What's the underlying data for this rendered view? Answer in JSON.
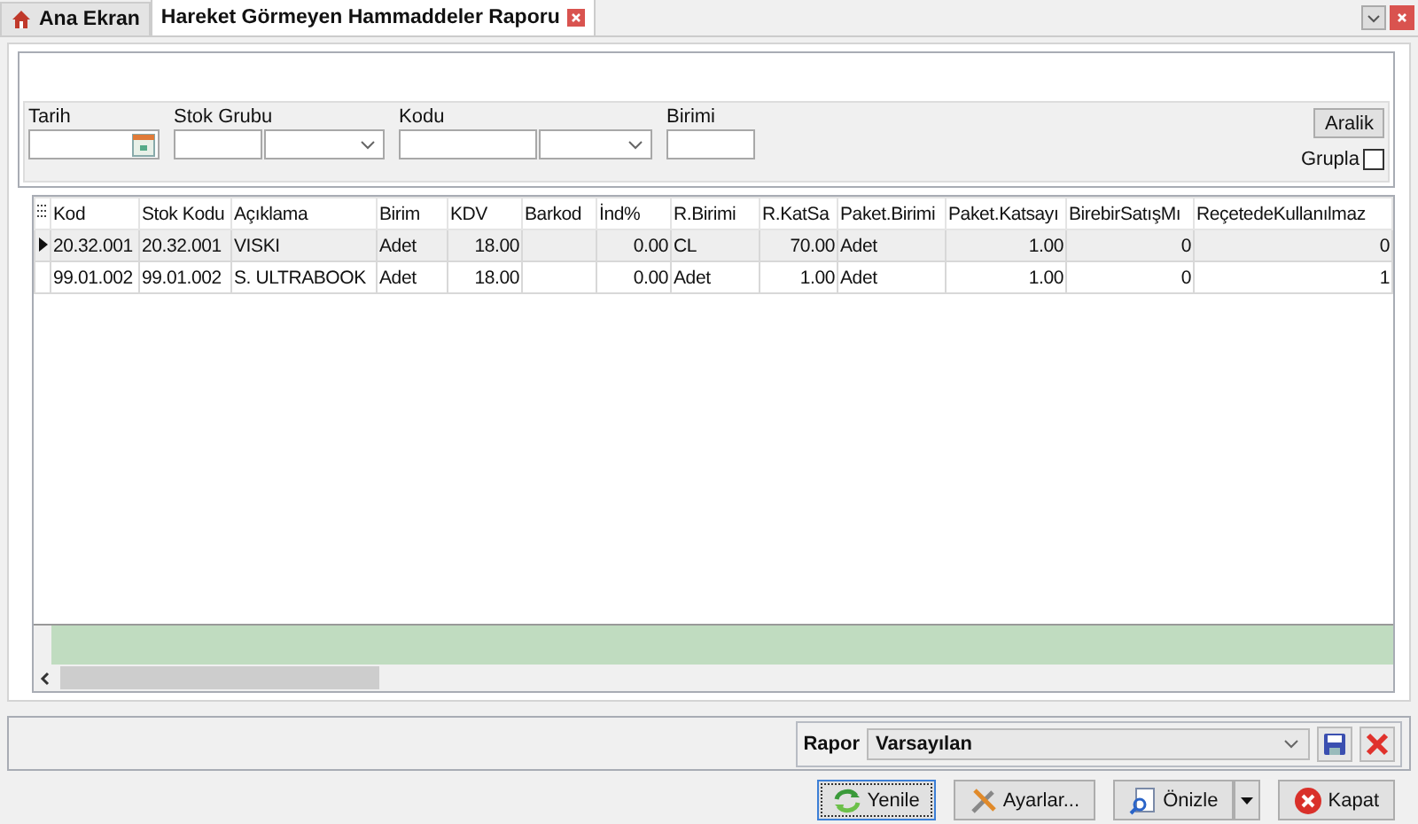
{
  "tabs": [
    {
      "label": "Ana Ekran",
      "selected": false,
      "kind": "home"
    },
    {
      "label": "Hareket Görmeyen Hammaddeler Raporu",
      "selected": true,
      "kind": "report"
    }
  ],
  "filters": [
    {
      "label": "Tarih",
      "kind": "date"
    },
    {
      "label": "Stok Grubu",
      "kind": "combo"
    },
    {
      "label": "Kodu",
      "kind": "combo"
    },
    {
      "label": "Birimi",
      "kind": "text"
    }
  ],
  "range_button": "Aralik",
  "group_checkbox": {
    "label": "Grupla",
    "checked": false
  },
  "table": {
    "columns": [
      {
        "label": "Kod",
        "kind": "text"
      },
      {
        "label": "Stok Kodu",
        "kind": "text"
      },
      {
        "label": "Açıklama",
        "kind": "text"
      },
      {
        "label": "Birim",
        "kind": "text"
      },
      {
        "label": "KDV",
        "kind": "number"
      },
      {
        "label": "Barkod",
        "kind": "text"
      },
      {
        "label": "İnd%",
        "kind": "number"
      },
      {
        "label": "R.Birimi",
        "kind": "text"
      },
      {
        "label": "R.KatSa",
        "kind": "number"
      },
      {
        "label": "Paket.Birimi",
        "kind": "text"
      },
      {
        "label": "Paket.Katsayı",
        "kind": "number"
      },
      {
        "label": "BirebirSatışMı",
        "kind": "number"
      },
      {
        "label": "ReçetedeKullanılmaz",
        "kind": "number"
      }
    ],
    "rows": [
      {
        "selected": true,
        "cells": [
          "20.32.001",
          "20.32.001",
          "VISKI",
          "Adet",
          "18.00",
          "",
          "0.00",
          "CL",
          "70.00",
          "Adet",
          "1.00",
          "0",
          "0"
        ]
      },
      {
        "selected": false,
        "cells": [
          "99.01.002",
          "99.01.002",
          "S. ULTRABOOK",
          "Adet",
          "18.00",
          "",
          "0.00",
          "Adet",
          "1.00",
          "Adet",
          "1.00",
          "0",
          "1"
        ]
      }
    ]
  },
  "report": {
    "label": "Rapor",
    "value": "Varsayılan"
  },
  "buttons": [
    {
      "label": "Yenile",
      "kind": "refresh",
      "focused": true
    },
    {
      "label": "Ayarlar...",
      "kind": "settings",
      "focused": false
    },
    {
      "label": "Önizle",
      "kind": "preview",
      "focused": false
    },
    {
      "label": "Kapat",
      "kind": "close",
      "focused": false
    }
  ]
}
